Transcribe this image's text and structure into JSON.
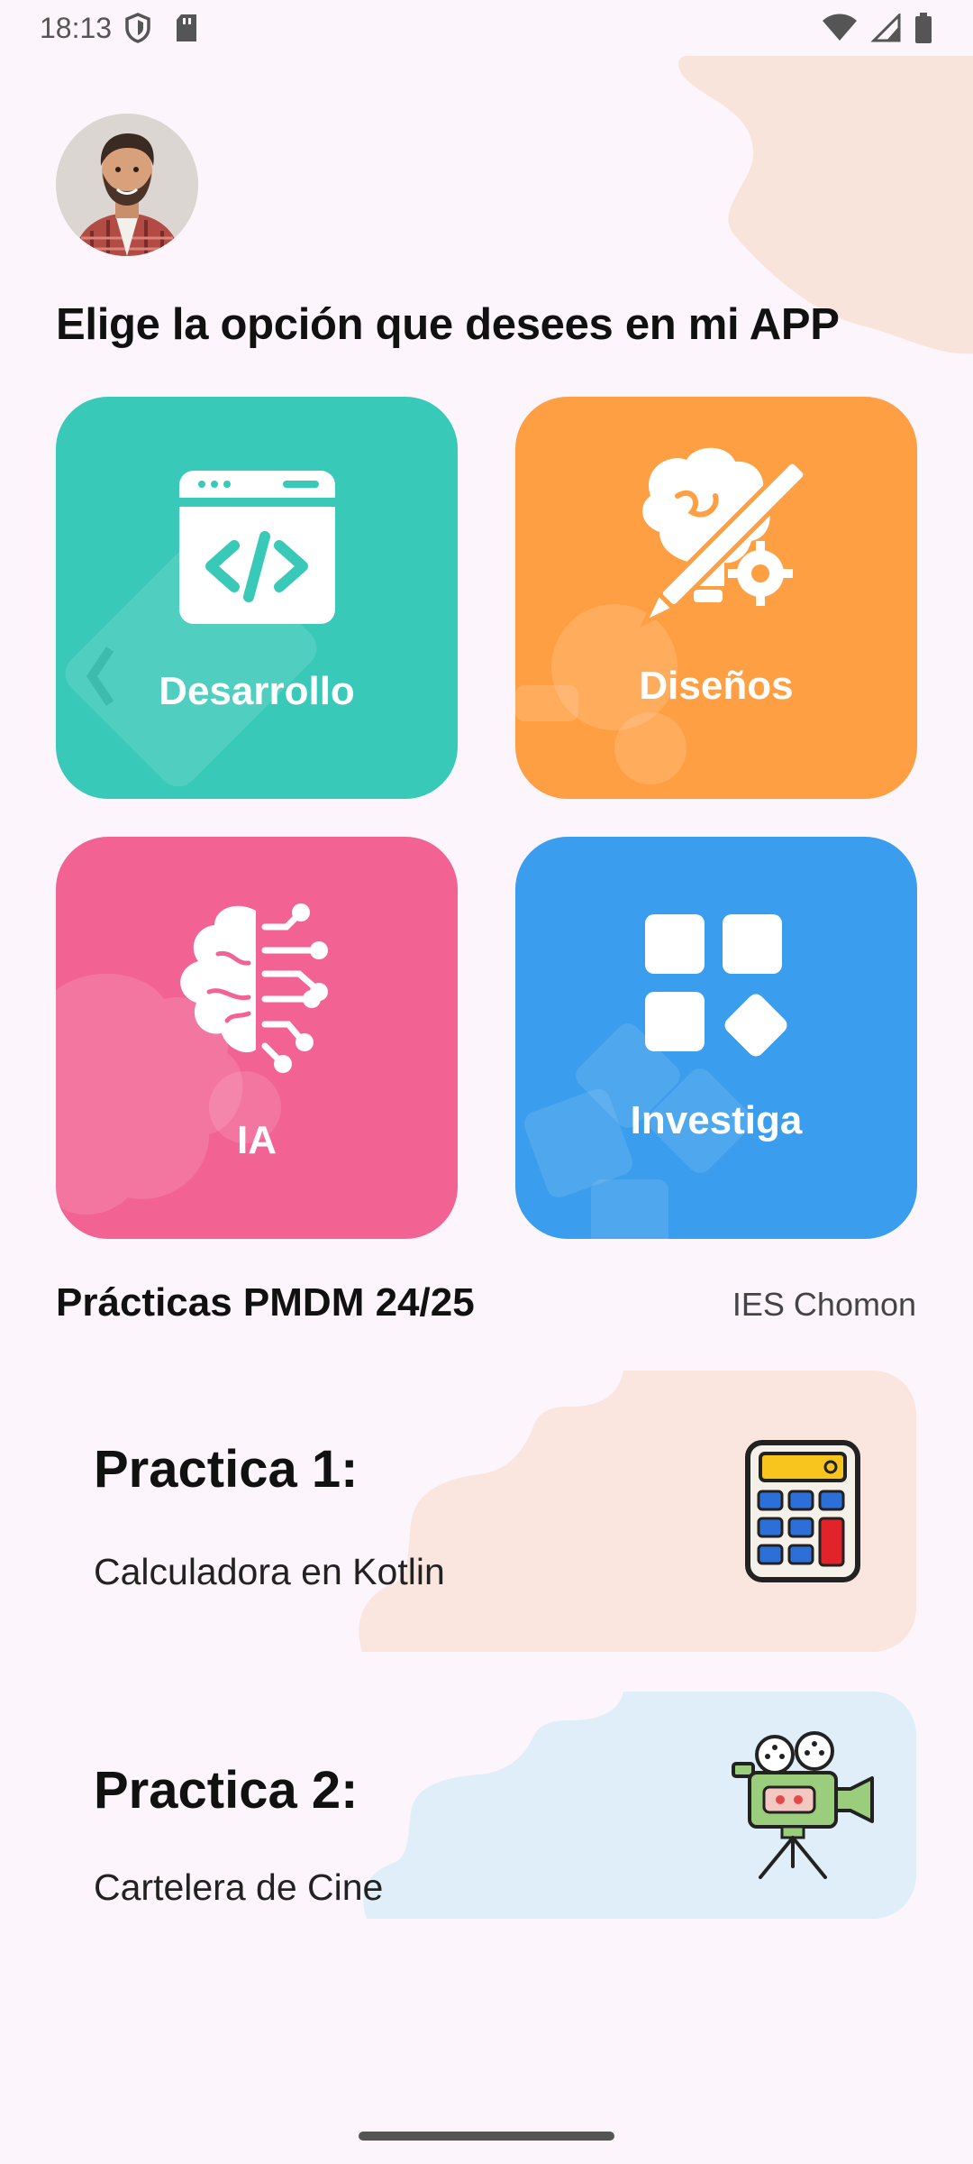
{
  "status_bar": {
    "time": "18:13",
    "left_icons": [
      "shield-icon",
      "sd-card-icon"
    ],
    "right_icons": [
      "wifi-icon",
      "signal-icon",
      "battery-icon"
    ]
  },
  "header": {
    "avatar": "user-avatar",
    "title": "Elige la opción que desees en mi APP"
  },
  "tiles": [
    {
      "label": "Desarrollo",
      "icon": "code-window-icon",
      "color": "#38c9b8"
    },
    {
      "label": "Diseños",
      "icon": "creative-design-icon",
      "color": "#ff9f43"
    },
    {
      "label": "IA",
      "icon": "ai-brain-icon",
      "color": "#f26394"
    },
    {
      "label": "Investiga",
      "icon": "apps-grid-icon",
      "color": "#3b9ded"
    }
  ],
  "section": {
    "title": "Prácticas PMDM 24/25",
    "subtitle": "IES Chomon"
  },
  "practices": [
    {
      "title": "Practica 1:",
      "description": "Calculadora en Kotlin",
      "icon": "calculator-icon",
      "color": "#fae5df"
    },
    {
      "title": "Practica 2:",
      "description": "Cartelera de Cine",
      "icon": "movie-camera-icon",
      "color": "#dfeef9"
    }
  ]
}
